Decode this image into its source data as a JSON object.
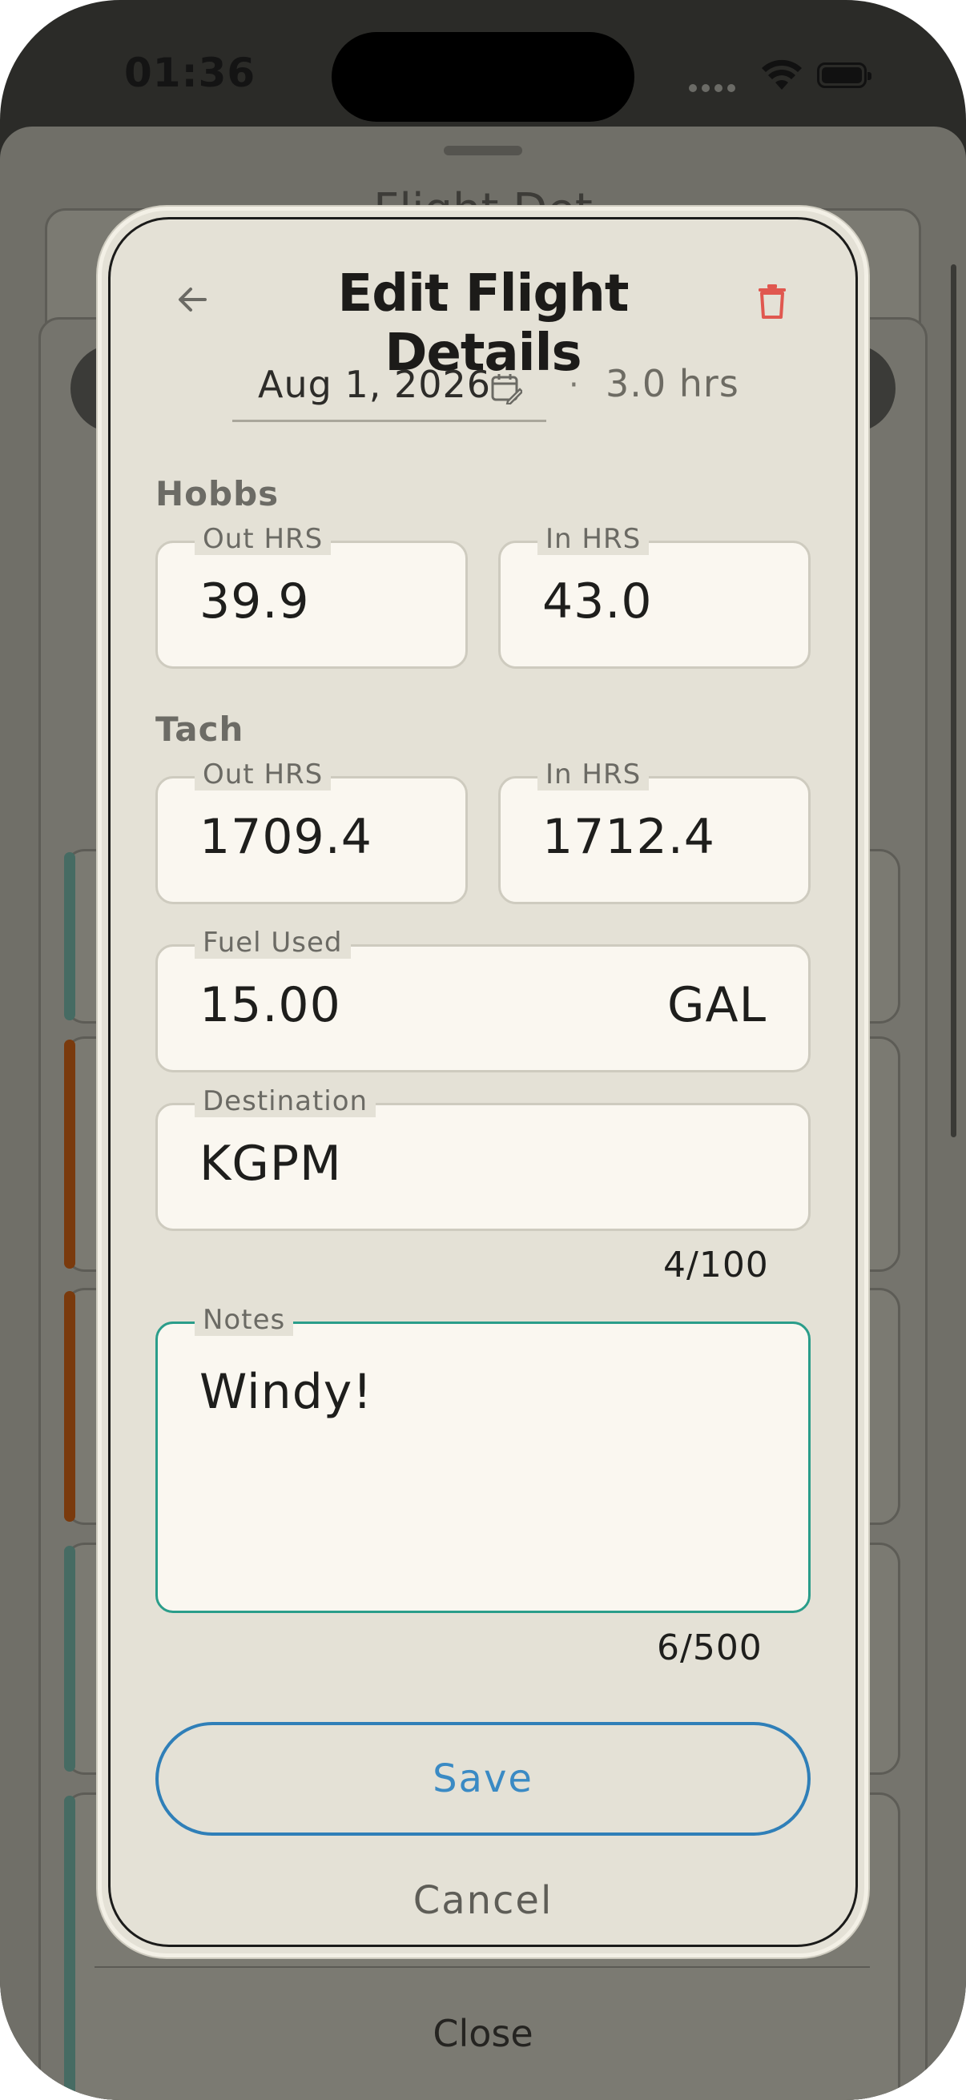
{
  "status_bar": {
    "time": "01:36"
  },
  "background_sheet": {
    "title": "Flight Det",
    "close_label": "Close"
  },
  "modal": {
    "title": "Edit Flight Details",
    "date": "Aug 1, 2026",
    "separator": "·",
    "duration": "3.0 hrs",
    "hobbs": {
      "label": "Hobbs",
      "out": {
        "label": "Out HRS",
        "value": "39.9"
      },
      "in": {
        "label": "In HRS",
        "value": "43.0"
      }
    },
    "tach": {
      "label": "Tach",
      "out": {
        "label": "Out HRS",
        "value": "1709.4"
      },
      "in": {
        "label": "In HRS",
        "value": "1712.4"
      }
    },
    "fuel": {
      "label": "Fuel Used",
      "value": "15.00",
      "unit": "GAL"
    },
    "destination": {
      "label": "Destination",
      "value": "KGPM",
      "counter": "4/100"
    },
    "notes": {
      "label": "Notes",
      "value": "Windy!",
      "counter": "6/500"
    },
    "save_label": "Save",
    "cancel_label": "Cancel"
  },
  "icons": {
    "back": "arrow-left-icon",
    "delete": "trash-icon",
    "calendar": "calendar-edit-icon"
  },
  "colors": {
    "accent_teal": "#2a9d8a",
    "save_blue": "#2f7fb8",
    "delete_red": "#e0574f",
    "modal_bg": "#e4e1d6",
    "field_bg": "#faf7f0"
  }
}
